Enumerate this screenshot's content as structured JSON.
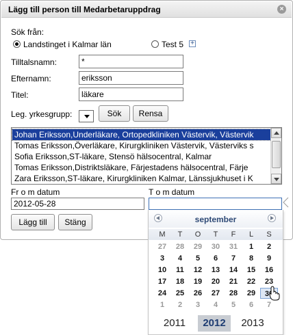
{
  "dialog": {
    "title": "Lägg till person till Medarbetaruppdrag",
    "close_glyph": "×"
  },
  "search_from": {
    "label": "Sök från:",
    "options": [
      {
        "label": "Landstinget i Kalmar län",
        "checked": true
      },
      {
        "label": "Test 5",
        "checked": false
      }
    ],
    "plus_glyph": "+"
  },
  "fields": {
    "first_name": {
      "label": "Tilltalsnamn:",
      "value": "*"
    },
    "last_name": {
      "label": "Efternamn:",
      "value": "eriksson"
    },
    "title": {
      "label": "Titel:",
      "value": "läkare"
    },
    "profession_group": {
      "label": "Leg. yrkesgrupp:",
      "value": ""
    }
  },
  "buttons": {
    "search": "Sök",
    "clear": "Rensa",
    "add": "Lägg till",
    "close": "Stäng"
  },
  "results": [
    {
      "text": "Johan Eriksson,Underläkare, Ortopedkliniken Västervik, Västervik",
      "selected": true
    },
    {
      "text": "Tomas Eriksson,Överläkare, Kirurgkliniken Västervik, Västerviks s",
      "selected": false
    },
    {
      "text": "Sofia Eriksson,ST-läkare, Stensö hälsocentral, Kalmar",
      "selected": false
    },
    {
      "text": "Tomas Eriksson,Distriktsläkare, Färjestadens hälsocentral, Färje",
      "selected": false
    },
    {
      "text": "Zara Eriksson,ST-läkare, Kirurgkliniken Kalmar, Länssjukhuset i K",
      "selected": false
    }
  ],
  "dates": {
    "from": {
      "label": "Fr o m datum",
      "value": "2012-05-28"
    },
    "to": {
      "label": "T o m datum",
      "value": ""
    }
  },
  "calendar": {
    "month": "september",
    "weekdays": [
      "M",
      "T",
      "O",
      "T",
      "F",
      "L",
      "S"
    ],
    "weeks": [
      [
        {
          "d": "27",
          "o": true
        },
        {
          "d": "28",
          "o": true
        },
        {
          "d": "29",
          "o": true
        },
        {
          "d": "30",
          "o": true
        },
        {
          "d": "31",
          "o": true
        },
        {
          "d": "1",
          "o": false
        },
        {
          "d": "2",
          "o": false
        }
      ],
      [
        {
          "d": "3",
          "o": false
        },
        {
          "d": "4",
          "o": false
        },
        {
          "d": "5",
          "o": false
        },
        {
          "d": "6",
          "o": false
        },
        {
          "d": "7",
          "o": false
        },
        {
          "d": "8",
          "o": false
        },
        {
          "d": "9",
          "o": false
        }
      ],
      [
        {
          "d": "10",
          "o": false
        },
        {
          "d": "11",
          "o": false
        },
        {
          "d": "12",
          "o": false
        },
        {
          "d": "13",
          "o": false
        },
        {
          "d": "14",
          "o": false
        },
        {
          "d": "15",
          "o": false
        },
        {
          "d": "16",
          "o": false
        }
      ],
      [
        {
          "d": "17",
          "o": false
        },
        {
          "d": "18",
          "o": false
        },
        {
          "d": "19",
          "o": false
        },
        {
          "d": "20",
          "o": false
        },
        {
          "d": "21",
          "o": false
        },
        {
          "d": "22",
          "o": false
        },
        {
          "d": "23",
          "o": false
        }
      ],
      [
        {
          "d": "24",
          "o": false
        },
        {
          "d": "25",
          "o": false
        },
        {
          "d": "26",
          "o": false
        },
        {
          "d": "27",
          "o": false
        },
        {
          "d": "28",
          "o": false
        },
        {
          "d": "29",
          "o": false
        },
        {
          "d": "30",
          "o": false
        }
      ],
      [
        {
          "d": "1",
          "o": true
        },
        {
          "d": "2",
          "o": true
        },
        {
          "d": "3",
          "o": true
        },
        {
          "d": "4",
          "o": true
        },
        {
          "d": "5",
          "o": true
        },
        {
          "d": "6",
          "o": true
        },
        {
          "d": "7",
          "o": true
        }
      ]
    ],
    "hovered_day": "30",
    "years": [
      {
        "label": "2011",
        "selected": false
      },
      {
        "label": "2012",
        "selected": true
      },
      {
        "label": "2013",
        "selected": false
      }
    ]
  },
  "colors": {
    "selection": "#1a3f9c",
    "calendar_month": "#2f4a76",
    "focus_border": "#3c6fb4"
  }
}
